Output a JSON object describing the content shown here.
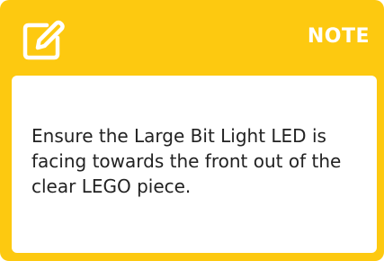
{
  "note": {
    "title": "NOTE",
    "body": "Ensure the Large Bit Light LED is facing towards the front out of the clear LEGO piece.",
    "icon": "edit-icon",
    "colors": {
      "accent": "#fdc910",
      "title_text": "#ffffff",
      "body_background": "#ffffff",
      "body_text": "#222222"
    }
  }
}
